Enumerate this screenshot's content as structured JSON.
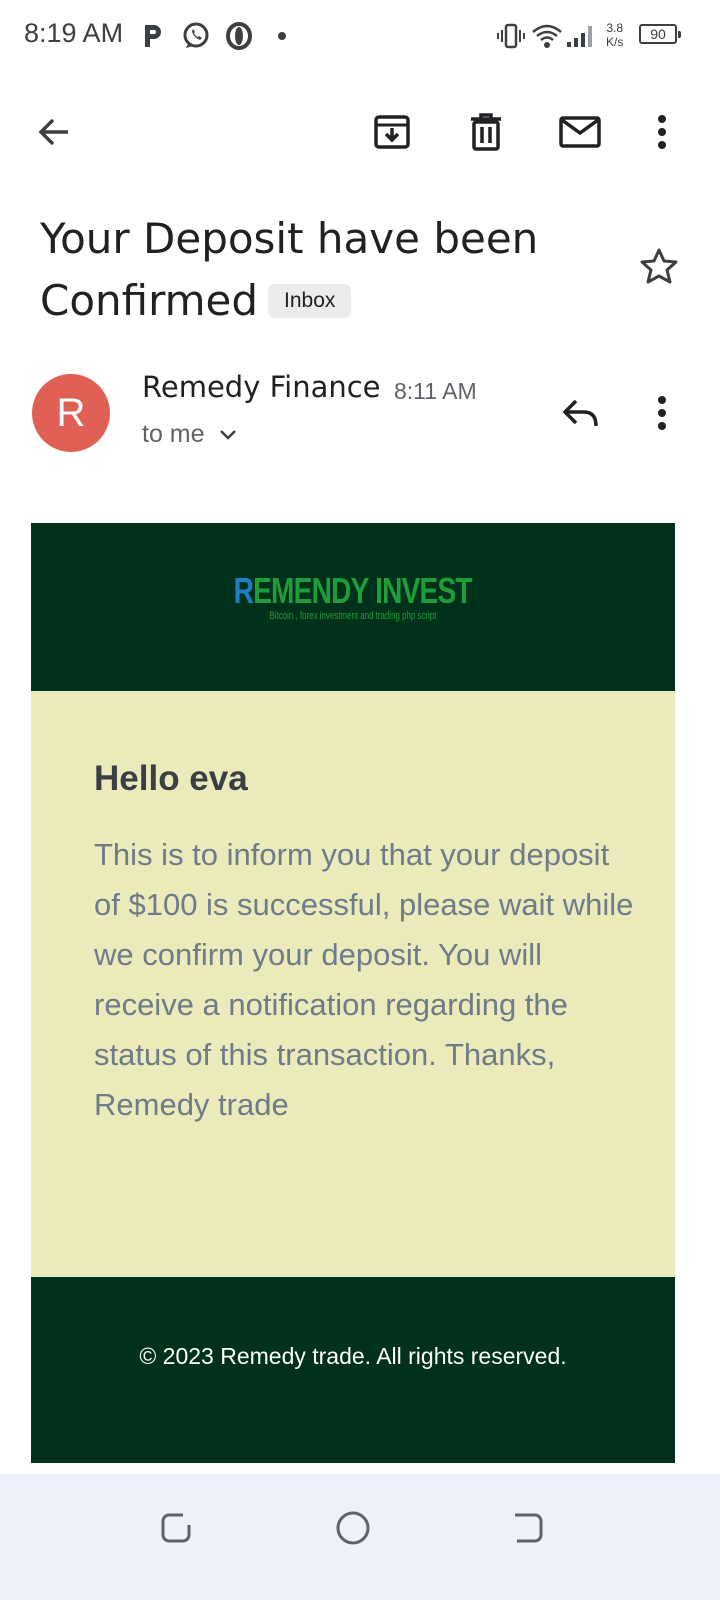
{
  "status_bar": {
    "time": "8:19 AM",
    "net_speed_value": "3.8",
    "net_speed_unit": "K/s",
    "battery": "90",
    "icons": [
      "p-app-icon",
      "whatsapp-icon",
      "opera-icon",
      "dot-icon",
      "vibrate-icon",
      "wifi-icon",
      "signal-icon"
    ]
  },
  "toolbar": {
    "icons": [
      "back-arrow-icon",
      "archive-icon",
      "delete-icon",
      "mark-unread-icon",
      "more-vert-icon"
    ]
  },
  "email": {
    "subject": "Your Deposit have been Confirmed",
    "label": "Inbox",
    "sender_initial": "R",
    "sender_name": "Remedy Finance",
    "time": "8:11 AM",
    "recipient": "to me"
  },
  "body": {
    "logo_title_first": "R",
    "logo_title_rest": "EMENDY INVEST",
    "logo_tagline": "Bitcoin , forex investment and trading php script",
    "greeting": "Hello eva",
    "message": "This is to inform you that your deposit of $100 is successful, please wait while we confirm your deposit. You will receive a notification regarding the status of this transaction. Thanks, Remedy trade",
    "footer": "© 2023 Remedy trade. All rights reserved."
  },
  "colors": {
    "header_bg": "#00311a",
    "content_bg": "#eaeabb",
    "avatar_bg": "#e06055",
    "message_text": "#6f7b89"
  },
  "nav_bar": {
    "icons": [
      "recents-icon",
      "home-icon",
      "back-icon"
    ]
  }
}
